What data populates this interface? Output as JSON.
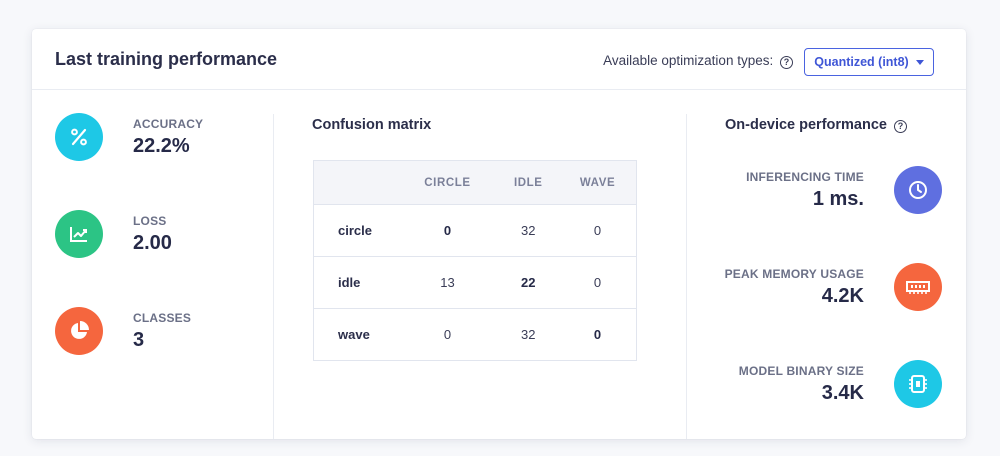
{
  "header": {
    "title": "Last training performance",
    "optimization_label": "Available optimization types:",
    "optimization_value": "Quantized (int8)"
  },
  "metrics": [
    {
      "label": "ACCURACY",
      "value": "22.2%",
      "icon": "percent-icon",
      "color": "#1ec8e6"
    },
    {
      "label": "LOSS",
      "value": "2.00",
      "icon": "trend-chart-icon",
      "color": "#2cc485"
    },
    {
      "label": "CLASSES",
      "value": "3",
      "icon": "pie-chart-icon",
      "color": "#f5663e"
    }
  ],
  "confusion_matrix": {
    "title": "Confusion matrix",
    "columns": [
      "CIRCLE",
      "IDLE",
      "WAVE"
    ],
    "rows": [
      {
        "label": "circle",
        "values": [
          "0",
          "32",
          "0"
        ]
      },
      {
        "label": "idle",
        "values": [
          "13",
          "22",
          "0"
        ]
      },
      {
        "label": "wave",
        "values": [
          "0",
          "32",
          "0"
        ]
      }
    ]
  },
  "on_device": {
    "title": "On-device performance",
    "items": [
      {
        "label": "INFERENCING TIME",
        "value": "1 ms.",
        "icon": "clock-icon",
        "color": "#5f6fe0"
      },
      {
        "label": "PEAK MEMORY USAGE",
        "value": "4.2K",
        "icon": "memory-chip-icon",
        "color": "#f5663e"
      },
      {
        "label": "MODEL BINARY SIZE",
        "value": "3.4K",
        "icon": "processor-icon",
        "color": "#1ec8e6"
      }
    ]
  }
}
